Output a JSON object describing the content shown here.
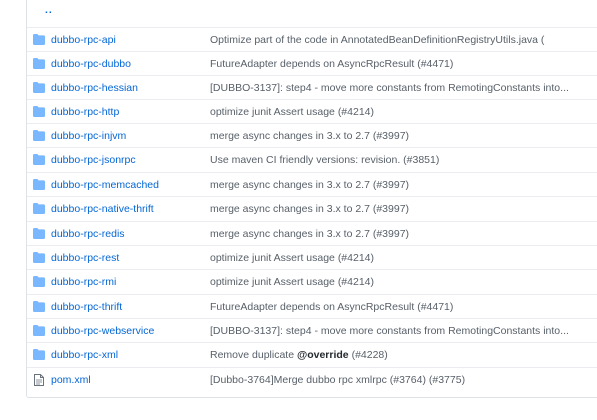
{
  "parent_link": "..",
  "entries": [
    {
      "type": "folder",
      "icon": "folder-icon",
      "name": "dubbo-rpc-api",
      "message": "Optimize part of the code in AnnotatedBeanDefinitionRegistryUtils.java ("
    },
    {
      "type": "folder",
      "icon": "folder-icon",
      "name": "dubbo-rpc-dubbo",
      "message": "FutureAdapter depends on AsyncRpcResult (#4471)"
    },
    {
      "type": "folder",
      "icon": "folder-icon",
      "name": "dubbo-rpc-hessian",
      "message": "[DUBBO-3137]: step4 - move more constants from RemotingConstants into..."
    },
    {
      "type": "folder",
      "icon": "folder-icon",
      "name": "dubbo-rpc-http",
      "message": "optimize junit Assert usage (#4214)"
    },
    {
      "type": "folder",
      "icon": "folder-icon",
      "name": "dubbo-rpc-injvm",
      "message": "merge async changes in 3.x to 2.7 (#3997)"
    },
    {
      "type": "folder",
      "icon": "folder-icon",
      "name": "dubbo-rpc-jsonrpc",
      "message": "Use maven CI friendly versions: revision. (#3851)"
    },
    {
      "type": "folder",
      "icon": "folder-icon",
      "name": "dubbo-rpc-memcached",
      "message": "merge async changes in 3.x to 2.7 (#3997)"
    },
    {
      "type": "folder",
      "icon": "folder-icon",
      "name": "dubbo-rpc-native-thrift",
      "message": "merge async changes in 3.x to 2.7 (#3997)"
    },
    {
      "type": "folder",
      "icon": "folder-icon",
      "name": "dubbo-rpc-redis",
      "message": "merge async changes in 3.x to 2.7 (#3997)"
    },
    {
      "type": "folder",
      "icon": "folder-icon",
      "name": "dubbo-rpc-rest",
      "message": "optimize junit Assert usage (#4214)"
    },
    {
      "type": "folder",
      "icon": "folder-icon",
      "name": "dubbo-rpc-rmi",
      "message": "optimize junit Assert usage (#4214)"
    },
    {
      "type": "folder",
      "icon": "folder-icon",
      "name": "dubbo-rpc-thrift",
      "message": "FutureAdapter depends on AsyncRpcResult (#4471)"
    },
    {
      "type": "folder",
      "icon": "folder-icon",
      "name": "dubbo-rpc-webservice",
      "message": "[DUBBO-3137]: step4 - move more constants from RemotingConstants into..."
    },
    {
      "type": "folder",
      "icon": "folder-icon",
      "name": "dubbo-rpc-xml",
      "message_prefix": "Remove duplicate ",
      "message_bold": "@override",
      "message_suffix": " (#4228)"
    },
    {
      "type": "file",
      "icon": "file-icon",
      "name": "pom.xml",
      "message": "[Dubbo-3764]Merge dubbo rpc xmlrpc (#3764) (#3775)"
    }
  ],
  "colors": {
    "folder": "#79b8ff",
    "link": "#0366d6",
    "file": "#6a737d"
  }
}
